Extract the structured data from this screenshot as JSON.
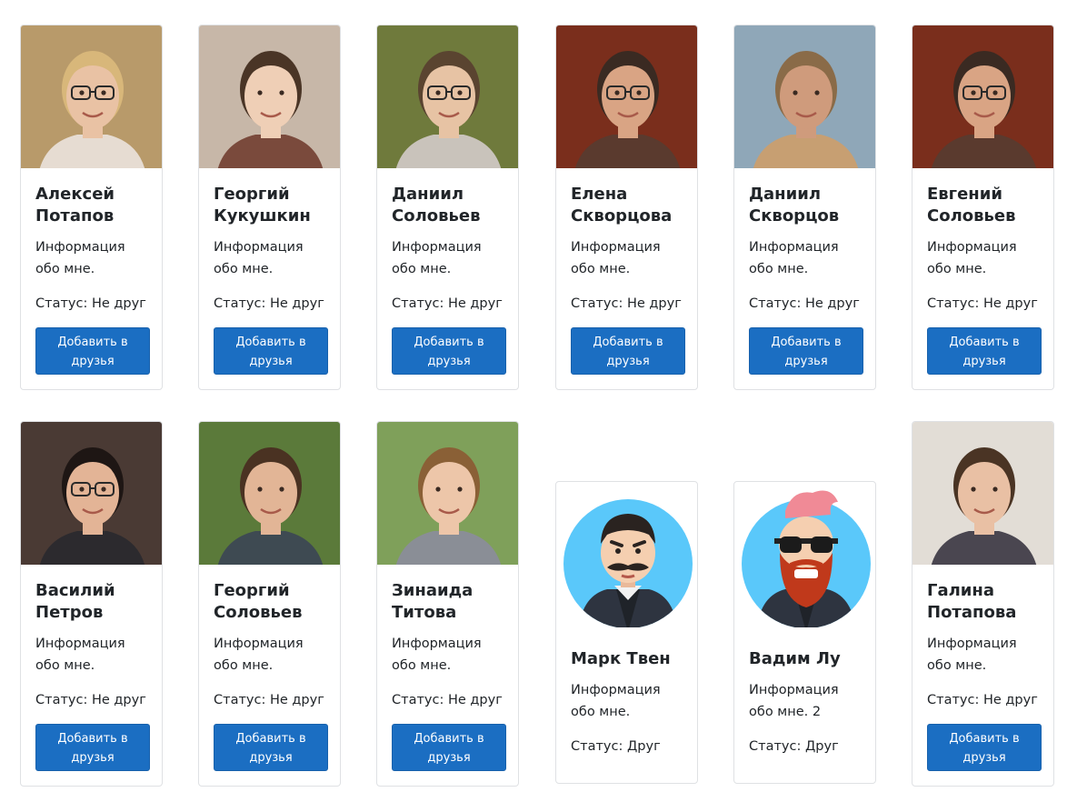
{
  "cards": [
    {
      "name": "Алексей\nПотапов",
      "info": "Информация\nобо мне.",
      "status": "Статус: Не друг",
      "button": "Добавить в друзья",
      "photo": {
        "bg": "#b89a6a",
        "skin": "#e9c2a4",
        "hair": "#d8b77a",
        "shirt": "#e6dcd2",
        "glasses": true
      }
    },
    {
      "name": "Георгий\nКукушкин",
      "info": "Информация\nобо мне.",
      "status": "Статус: Не друг",
      "button": "Добавить в друзья",
      "photo": {
        "bg": "#c7b7a8",
        "skin": "#efcfb6",
        "hair": "#4a3526",
        "shirt": "#7a4a3c",
        "glasses": false
      }
    },
    {
      "name": "Даниил\nСоловьев",
      "info": "Информация\nобо мне.",
      "status": "Статус: Не друг",
      "button": "Добавить в друзья",
      "photo": {
        "bg": "#6f7a3c",
        "skin": "#e7c3a4",
        "hair": "#5a4430",
        "shirt": "#c9c3bb",
        "glasses": true
      }
    },
    {
      "name": "Елена\nСкворцова",
      "info": "Информация\nобо мне.",
      "status": "Статус: Не друг",
      "button": "Добавить в друзья",
      "photo": {
        "bg": "#7a2e1c",
        "skin": "#d9a484",
        "hair": "#3a2a22",
        "shirt": "#5a3a2e",
        "glasses": true
      }
    },
    {
      "name": "Даниил\nСкворцов",
      "info": "Информация\nобо мне.",
      "status": "Статус: Не друг",
      "button": "Добавить в друзья",
      "photo": {
        "bg": "#8fa7b8",
        "skin": "#cf9b7c",
        "hair": "#8a6b48",
        "shirt": "#c79f72",
        "glasses": false
      }
    },
    {
      "name": "Евгений\nСоловьев",
      "info": "Информация\nобо мне.",
      "status": "Статус: Не друг",
      "button": "Добавить в друзья",
      "photo": {
        "bg": "#7a2e1c",
        "skin": "#d9a484",
        "hair": "#3a2a22",
        "shirt": "#5a3a2e",
        "glasses": true
      }
    },
    {
      "name": "Василий\nПетров",
      "info": "Информация\nобо мне.",
      "status": "Статус: Не друг",
      "button": "Добавить в друзья",
      "photo": {
        "bg": "#4a3a34",
        "skin": "#e3b496",
        "hair": "#1e1614",
        "shirt": "#2c2a2e",
        "glasses": true
      }
    },
    {
      "name": "Георгий\nСоловьев",
      "info": "Информация\nобо мне.",
      "status": "Статус: Не друг",
      "button": "Добавить в друзья",
      "photo": {
        "bg": "#5b7a3a",
        "skin": "#e2b596",
        "hair": "#4a3222",
        "shirt": "#3e4a52",
        "glasses": false
      }
    },
    {
      "name": "Зинаида\nТитова",
      "info": "Информация\nобо мне.",
      "status": "Статус: Не друг",
      "button": "Добавить в друзья",
      "photo": {
        "bg": "#7fa05a",
        "skin": "#edc6a9",
        "hair": "#8a6036",
        "shirt": "#8a8e96",
        "glasses": false
      }
    },
    {
      "name": "Марк Твен",
      "info": "Информация\nобо мне.",
      "status": "Статус: Друг",
      "button": null,
      "avatar": "cartoon-mustache"
    },
    {
      "name": "Вадим Лу",
      "info": "Информация\nобо мне. 2",
      "status": "Статус: Друг",
      "button": null,
      "avatar": "cartoon-beard"
    },
    {
      "name": "Галина\nПотапова",
      "info": "Информация\nобо мне.",
      "status": "Статус: Не друг",
      "button": "Добавить в друзья",
      "photo": {
        "bg": "#e2ddd6",
        "skin": "#e9c0a4",
        "hair": "#4a3424",
        "shirt": "#4a4650",
        "glasses": false
      }
    }
  ]
}
